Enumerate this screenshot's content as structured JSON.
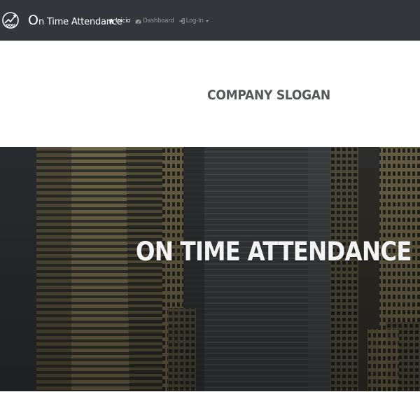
{
  "navbar": {
    "brand_initial": "O",
    "brand_rest": "n Time Attendance",
    "items": [
      {
        "label": "Inicio",
        "icon": "home-icon",
        "active": true
      },
      {
        "label": "Dashboard",
        "icon": "dashboard-icon",
        "active": false
      },
      {
        "label": "Log-In",
        "icon": "login-icon",
        "active": false,
        "dropdown": true
      }
    ]
  },
  "slogan": {
    "text": "COMPANY SLOGAN"
  },
  "hero": {
    "title": "ON TIME ATTENDANCE",
    "background": "city-buildings-image"
  },
  "colors": {
    "navbar_bg": "#34363b",
    "nav_active": "#ffffff",
    "nav_inactive": "#9a9a9a",
    "slogan_text": "#555759",
    "hero_text": "#f4f4f4"
  }
}
